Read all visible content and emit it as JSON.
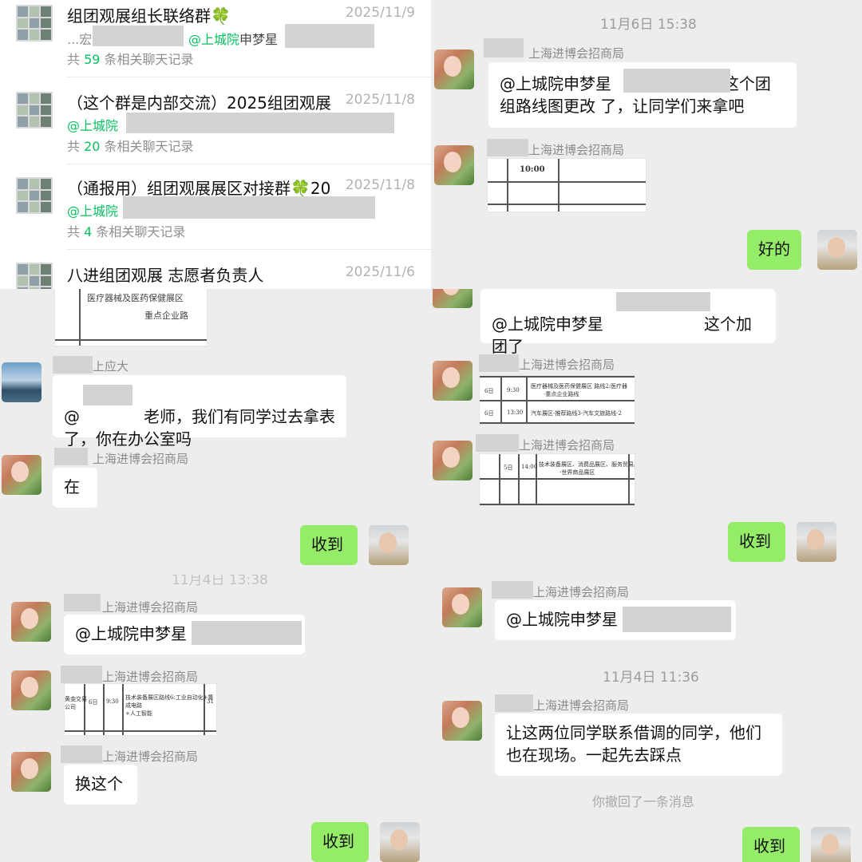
{
  "search_results": [
    {
      "title": "组团观展组长联络群🍀",
      "date": "2025/11/9",
      "snippet_prefix": "...宏",
      "snippet_mention": "@上城院",
      "snippet_after": "申梦星",
      "count_prefix": "共 ",
      "count": "59",
      "count_suffix": " 条相关聊天记录"
    },
    {
      "title": "（这个群是内部交流）2025组团观展",
      "date": "2025/11/8",
      "snippet_prefix": "",
      "snippet_mention": "@上城院",
      "snippet_after": "",
      "count_prefix": "共 ",
      "count": "20",
      "count_suffix": " 条相关聊天记录"
    },
    {
      "title": "（通报用）组团观展展区对接群🍀20",
      "date": "2025/11/8",
      "snippet_prefix": "",
      "snippet_mention": "@上城院",
      "snippet_after": "",
      "count_prefix": "共 ",
      "count": "4",
      "count_suffix": " 条相关聊天记录"
    },
    {
      "title": "八进组团观展 志愿者负责人",
      "date": "2025/11/6"
    }
  ],
  "chat_tr": {
    "time": "11月6日 15:38",
    "sender": "上海进博会招商局",
    "msg1": "@上城院申梦星                      这个团\n组路线图更改 了，让同学们来拿吧",
    "img_text": "10:00",
    "reply": "好的"
  },
  "chat_ml": {
    "sender1": "上应大",
    "msg1_a": "@",
    "msg1_b": "老师，我们有同学过去拿表\n了，你在办公室吗",
    "sender2": "上海进博会招商局",
    "msg2": "在",
    "reply": "收到"
  },
  "chat_mr": {
    "msg1_a": "@上城院申梦星",
    "msg1_b": "这个加\n团了",
    "sender": "上海进博会招商局",
    "img1_r1": [
      "6日",
      "9:30",
      "医疗器械及医药保健展区  路线2:医疗器",
      "-重点企业路线"
    ],
    "img1_r2": [
      "6日",
      "13:30",
      "汽车展区-推荐路线3-汽车文旅路线-2"
    ],
    "img2_r1": [
      "5日",
      "14:00",
      "技术装备展区、消费品展区、服务贸易展区",
      "-世界商品展区"
    ],
    "reply": "收到"
  },
  "chat_bl": {
    "time": "11月4日 13:38",
    "sender": "上海进博会招商局",
    "msg1": "@上城院申梦星",
    "img_cells": [
      "黄金交易\n公司",
      "6日",
      "9:30",
      "技术装备展区路线6:工业自动化+集成电路\n+人工智能",
      "31"
    ],
    "msg2": "换这个",
    "reply": "收到"
  },
  "chat_br": {
    "sender": "上海进博会招商局",
    "msg1": "@上城院申梦星",
    "time": "11月4日 11:36",
    "msg2": "让这两位同学联系借调的同学，他们\n也在现场。一起先去踩点",
    "recall": "你撤回了一条消息",
    "reply": "收到"
  }
}
